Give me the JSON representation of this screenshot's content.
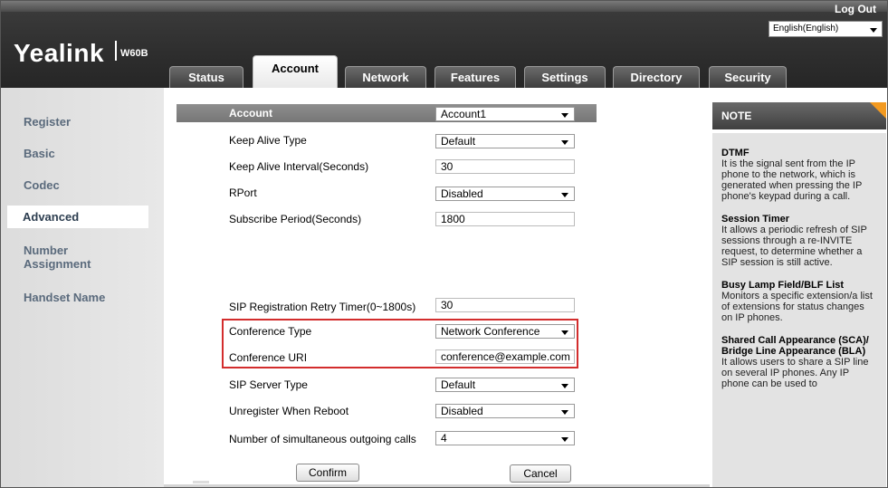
{
  "header": {
    "logo": "Yealink",
    "model": "W60B",
    "logout_label": "Log Out",
    "language": "English(English)"
  },
  "tabs": [
    {
      "label": "Status",
      "active": false
    },
    {
      "label": "Account",
      "active": true
    },
    {
      "label": "Network",
      "active": false
    },
    {
      "label": "Features",
      "active": false
    },
    {
      "label": "Settings",
      "active": false
    },
    {
      "label": "Directory",
      "active": false
    },
    {
      "label": "Security",
      "active": false
    }
  ],
  "sidebar": {
    "items": [
      {
        "label": "Register"
      },
      {
        "label": "Basic"
      },
      {
        "label": "Codec"
      },
      {
        "label": "Advanced",
        "active": true
      },
      {
        "label": "Number Assignment"
      },
      {
        "label": "Handset Name"
      }
    ]
  },
  "form": {
    "account_label": "Account",
    "account_value": "Account1",
    "keep_alive_type_label": "Keep Alive Type",
    "keep_alive_type_value": "Default",
    "keep_alive_interval_label": "Keep Alive Interval(Seconds)",
    "keep_alive_interval_value": "30",
    "rport_label": "RPort",
    "rport_value": "Disabled",
    "subscribe_period_label": "Subscribe Period(Seconds)",
    "subscribe_period_value": "1800",
    "sip_retry_label": "SIP Registration Retry Timer(0~1800s)",
    "sip_retry_value": "30",
    "conference_type_label": "Conference Type",
    "conference_type_value": "Network Conference",
    "conference_uri_label": "Conference URI",
    "conference_uri_value": "conference@example.com",
    "sip_server_type_label": "SIP Server Type",
    "sip_server_type_value": "Default",
    "unregister_label": "Unregister When Reboot",
    "unregister_value": "Disabled",
    "outgoing_calls_label": "Number of simultaneous outgoing calls",
    "outgoing_calls_value": "4",
    "confirm_label": "Confirm",
    "cancel_label": "Cancel"
  },
  "note": {
    "title": "NOTE",
    "items": [
      {
        "title": "DTMF",
        "text": "It is the signal sent from the IP phone to the network, which is generated when pressing the IP phone's keypad during a call."
      },
      {
        "title": "Session Timer",
        "text": "It allows a periodic refresh of SIP sessions through a re-INVITE request, to determine whether a SIP session is still active."
      },
      {
        "title": "Busy Lamp Field/BLF List",
        "text": "Monitors a specific extension/a list of extensions for status changes on IP phones."
      },
      {
        "title": "Shared Call Appearance (SCA)/ Bridge Line Appearance (BLA)",
        "text": "It allows users to share a SIP line on several IP phones. Any IP phone can be used to"
      }
    ]
  },
  "colors": {
    "highlight": "#d32d2d",
    "note_corner": "#f39a20",
    "nav_text": "#5a6a7c"
  }
}
